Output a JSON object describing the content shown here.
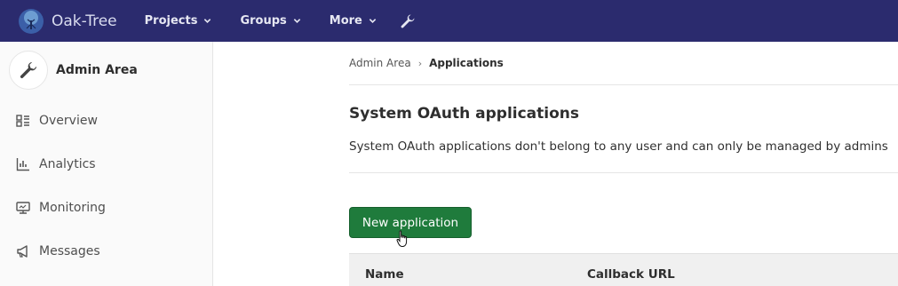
{
  "navbar": {
    "brand": "Oak-Tree",
    "items": [
      {
        "label": "Projects",
        "icon": "chevron-down-icon"
      },
      {
        "label": "Groups",
        "icon": "chevron-down-icon"
      },
      {
        "label": "More",
        "icon": "chevron-down-icon"
      }
    ],
    "admin_icon": "wrench-icon",
    "background": "#2b2b6e"
  },
  "sidebar": {
    "title": "Admin Area",
    "icon": "wrench-icon",
    "items": [
      {
        "label": "Overview",
        "icon": "overview-icon"
      },
      {
        "label": "Analytics",
        "icon": "analytics-icon"
      },
      {
        "label": "Monitoring",
        "icon": "monitor-icon"
      },
      {
        "label": "Messages",
        "icon": "megaphone-icon"
      }
    ]
  },
  "breadcrumb": {
    "parent": "Admin Area",
    "current": "Applications"
  },
  "main": {
    "title": "System OAuth applications",
    "description": "System OAuth applications don't belong to any user and can only be managed by admins",
    "new_button": "New application",
    "button_color": "#1f7b3c",
    "table": {
      "columns": [
        "Name",
        "Callback URL"
      ]
    }
  }
}
